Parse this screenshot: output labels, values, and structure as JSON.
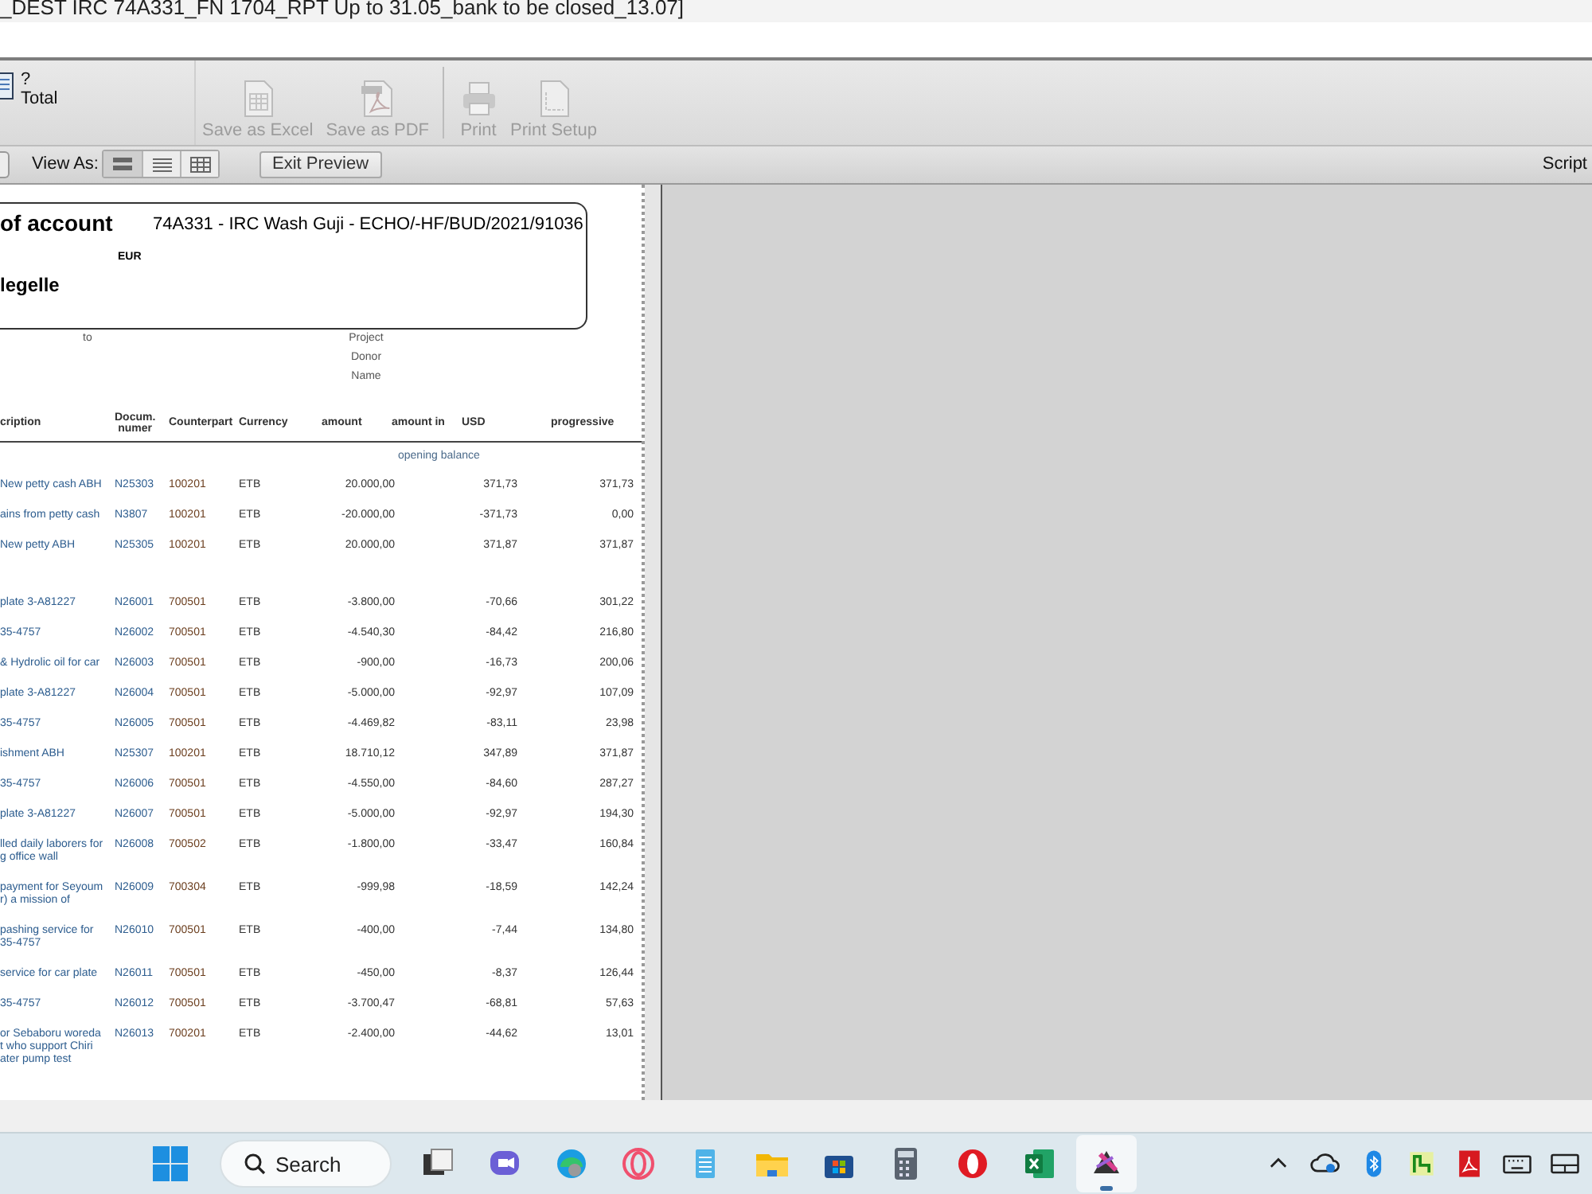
{
  "window": {
    "title": "_DEST IRC 74A331_FN 1704_RPT Up to 31.05_bank to be closed_13.07]"
  },
  "toolbar": {
    "layout_label": "?",
    "layout_name": "Total",
    "buttons": [
      {
        "kind": "excel",
        "label": "Save as Excel",
        "disabled": true
      },
      {
        "kind": "pdf",
        "label": "Save as PDF",
        "disabled": true
      },
      {
        "kind": "print",
        "label": "Print",
        "disabled": true
      },
      {
        "kind": "setup",
        "label": "Print Setup",
        "disabled": true
      }
    ]
  },
  "view_bar": {
    "view_as_label": "View As:",
    "views": [
      {
        "kind": "form",
        "selected": true
      },
      {
        "kind": "list",
        "selected": false
      },
      {
        "kind": "table",
        "selected": false
      }
    ],
    "exit_button": "Exit Preview",
    "script_label": "Script"
  },
  "report": {
    "title": "of account",
    "project": "74A331 - IRC Wash Guji - ECHO/-HF/BUD/2021/91036",
    "currency": "EUR",
    "name": "legelle",
    "to_label": "to",
    "project_labels": [
      "Project",
      "Donor",
      "Name"
    ],
    "columns": [
      "cription",
      "Docum.\nnumer",
      "Counterpart",
      "Currency",
      "amount",
      "amount in",
      "USD",
      "progressive"
    ],
    "opening_balance": "opening balance",
    "rows": [
      {
        "description": [
          "New petty cash ABH"
        ],
        "doc": "N25303",
        "counterpart": "100201",
        "currency": "ETB",
        "amount": "20.000,00",
        "usd": "371,73",
        "progressive": "371,73"
      },
      {
        "description": [
          "ains from petty  cash"
        ],
        "doc": "N3807",
        "counterpart": "100201",
        "currency": "ETB",
        "amount": "-20.000,00",
        "usd": "-371,73",
        "progressive": "0,00"
      },
      {
        "description": [
          "New petty ABH"
        ],
        "doc": "N25305",
        "counterpart": "100201",
        "currency": "ETB",
        "amount": "20.000,00",
        "usd": "371,87",
        "progressive": "371,87"
      },
      {
        "description": [
          "plate 3-A81227"
        ],
        "doc": "N26001",
        "counterpart": "700501",
        "currency": "ETB",
        "amount": "-3.800,00",
        "usd": "-70,66",
        "progressive": "301,22"
      },
      {
        "description": [
          "35-4757"
        ],
        "doc": "N26002",
        "counterpart": "700501",
        "currency": "ETB",
        "amount": "-4.540,30",
        "usd": "-84,42",
        "progressive": "216,80"
      },
      {
        "description": [
          "& Hydrolic oil for car"
        ],
        "doc": "N26003",
        "counterpart": "700501",
        "currency": "ETB",
        "amount": "-900,00",
        "usd": "-16,73",
        "progressive": "200,06"
      },
      {
        "description": [
          "plate 3-A81227"
        ],
        "doc": "N26004",
        "counterpart": "700501",
        "currency": "ETB",
        "amount": "-5.000,00",
        "usd": "-92,97",
        "progressive": "107,09"
      },
      {
        "description": [
          "35-4757"
        ],
        "doc": "N26005",
        "counterpart": "700501",
        "currency": "ETB",
        "amount": "-4.469,82",
        "usd": "-83,11",
        "progressive": "23,98"
      },
      {
        "description": [
          "ishment ABH"
        ],
        "doc": "N25307",
        "counterpart": "100201",
        "currency": "ETB",
        "amount": "18.710,12",
        "usd": "347,89",
        "progressive": "371,87"
      },
      {
        "description": [
          "35-4757"
        ],
        "doc": "N26006",
        "counterpart": "700501",
        "currency": "ETB",
        "amount": "-4.550,00",
        "usd": "-84,60",
        "progressive": "287,27"
      },
      {
        "description": [
          "plate 3-A81227"
        ],
        "doc": "N26007",
        "counterpart": "700501",
        "currency": "ETB",
        "amount": "-5.000,00",
        "usd": "-92,97",
        "progressive": "194,30"
      },
      {
        "description": [
          "lled daily laborers for",
          "g  office wall"
        ],
        "doc": "N26008",
        "counterpart": "700502",
        "currency": "ETB",
        "amount": "-1.800,00",
        "usd": "-33,47",
        "progressive": "160,84"
      },
      {
        "description": [
          "payment for Seyoum",
          "r) a mission of"
        ],
        "doc": "N26009",
        "counterpart": "700304",
        "currency": "ETB",
        "amount": "-999,98",
        "usd": "-18,59",
        "progressive": "142,24"
      },
      {
        "description": [
          "pashing service for",
          "35-4757"
        ],
        "doc": "N26010",
        "counterpart": "700501",
        "currency": "ETB",
        "amount": "-400,00",
        "usd": "-7,44",
        "progressive": "134,80"
      },
      {
        "description": [
          "service for car plate"
        ],
        "doc": "N26011",
        "counterpart": "700501",
        "currency": "ETB",
        "amount": "-450,00",
        "usd": "-8,37",
        "progressive": "126,44"
      },
      {
        "description": [
          "35-4757"
        ],
        "doc": "N26012",
        "counterpart": "700501",
        "currency": "ETB",
        "amount": "-3.700,47",
        "usd": "-68,81",
        "progressive": "57,63"
      },
      {
        "description": [
          "or Sebaboru woreda",
          "t who support Chiri",
          "ater pump test"
        ],
        "doc": "N26013",
        "counterpart": "700201",
        "currency": "ETB",
        "amount": "-2.400,00",
        "usd": "-44,62",
        "progressive": "13,01"
      }
    ]
  },
  "taskbar": {
    "search_label": "Search",
    "apps": [
      {
        "kind": "taskview",
        "selected": false
      },
      {
        "kind": "chat",
        "selected": false
      },
      {
        "kind": "edge",
        "selected": false
      },
      {
        "kind": "operagx",
        "selected": false
      },
      {
        "kind": "notepad",
        "selected": false
      },
      {
        "kind": "folder",
        "selected": false
      },
      {
        "kind": "store",
        "selected": false
      },
      {
        "kind": "calculator",
        "selected": false
      },
      {
        "kind": "opera",
        "selected": false
      },
      {
        "kind": "excel",
        "selected": false
      },
      {
        "kind": "filemaker",
        "selected": true
      }
    ],
    "tray": [
      {
        "kind": "caret"
      },
      {
        "kind": "cloud"
      },
      {
        "kind": "bluetooth"
      },
      {
        "kind": "green"
      },
      {
        "kind": "pdf"
      },
      {
        "kind": "keyboard"
      },
      {
        "kind": "screen"
      }
    ]
  }
}
